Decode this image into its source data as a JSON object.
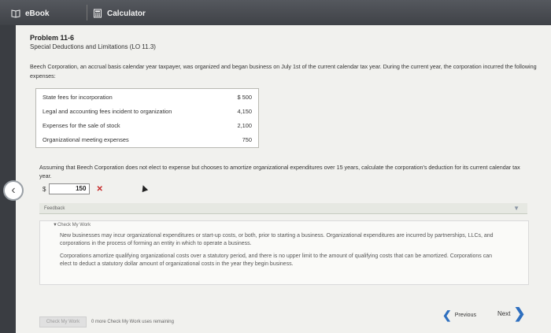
{
  "tabs": [
    {
      "label": "eBook",
      "icon": "book-icon"
    },
    {
      "label": "Calculator",
      "icon": "calculator-icon"
    }
  ],
  "problem": {
    "title": "Problem 11-6",
    "subtitle": "Special Deductions and Limitations (LO 11.3)",
    "paragraph": "Beech Corporation, an accrual basis calendar year taxpayer, was organized and began business on July 1st of the current calendar tax year. During the current year, the corporation incurred the following expenses:"
  },
  "expenses": [
    {
      "label": "State fees for incorporation",
      "amount": "$ 500"
    },
    {
      "label": "Legal and accounting fees incident to organization",
      "amount": "4,150"
    },
    {
      "label": "Expenses for the sale of stock",
      "amount": "2,100"
    },
    {
      "label": "Organizational meeting expenses",
      "amount": "750"
    }
  ],
  "question": "Assuming that Beech Corporation does not elect to expense but chooses to amortize organizational expenditures over 15 years, calculate the corporation's deduction for its current calendar tax year.",
  "answer": {
    "currency": "$",
    "value": "150",
    "status": "✕"
  },
  "feedback": {
    "header": "Feedback",
    "check_label": "▼Check My Work",
    "line1": "New businesses may incur organizational expenditures or start-up costs, or both, prior to starting a business. Organizational expenditures are incurred by partnerships, LLCs, and corporations in the process of forming an entity in which to operate a business.",
    "line2": "Corporations amortize qualifying organizational costs over a statutory period, and there is no upper limit to the amount of qualifying costs that can be amortized. Corporations can elect to deduct a statutory dollar amount of organizational costs in the year they begin business."
  },
  "footer": {
    "check_button": "Check My Work",
    "remaining": "0 more Check My Work uses remaining",
    "previous": "Previous",
    "next": "Next"
  },
  "colors": {
    "accent": "#2e6fbf",
    "error": "#c62828",
    "background": "#f1f1ee"
  }
}
